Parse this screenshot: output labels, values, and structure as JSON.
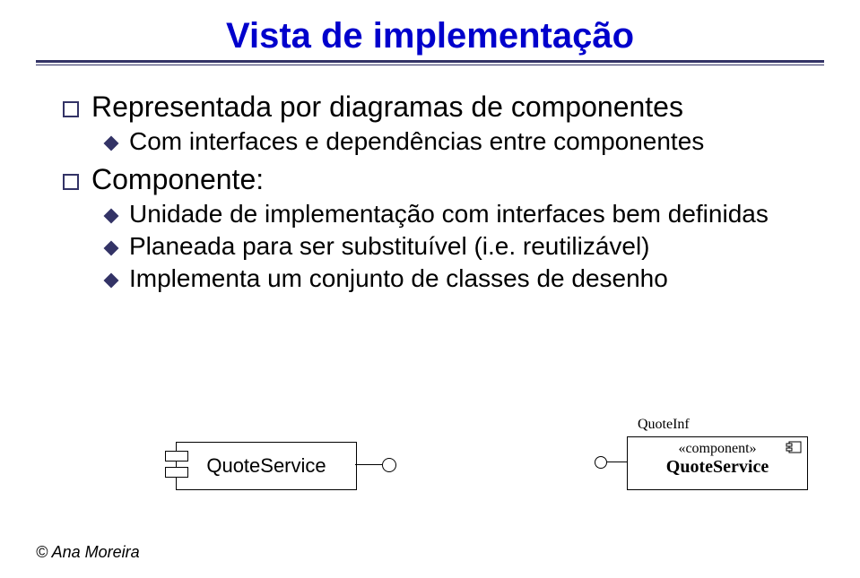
{
  "title": "Vista de implementação",
  "bullets": {
    "b1": "Representada por diagramas de componentes",
    "b1a": "Com interfaces e dependências entre componentes",
    "b2": "Componente:",
    "b2a": "Unidade de implementação com interfaces bem definidas",
    "b2b": "Planeada para ser substituível (i.e. reutilizável)",
    "b2c": "Implementa um conjunto de classes de desenho"
  },
  "uml_left": {
    "component_name": "QuoteService"
  },
  "uml_right": {
    "interface_label": "QuoteInf",
    "stereotype": "«component»",
    "component_name": "QuoteService"
  },
  "footer": "© Ana Moreira"
}
